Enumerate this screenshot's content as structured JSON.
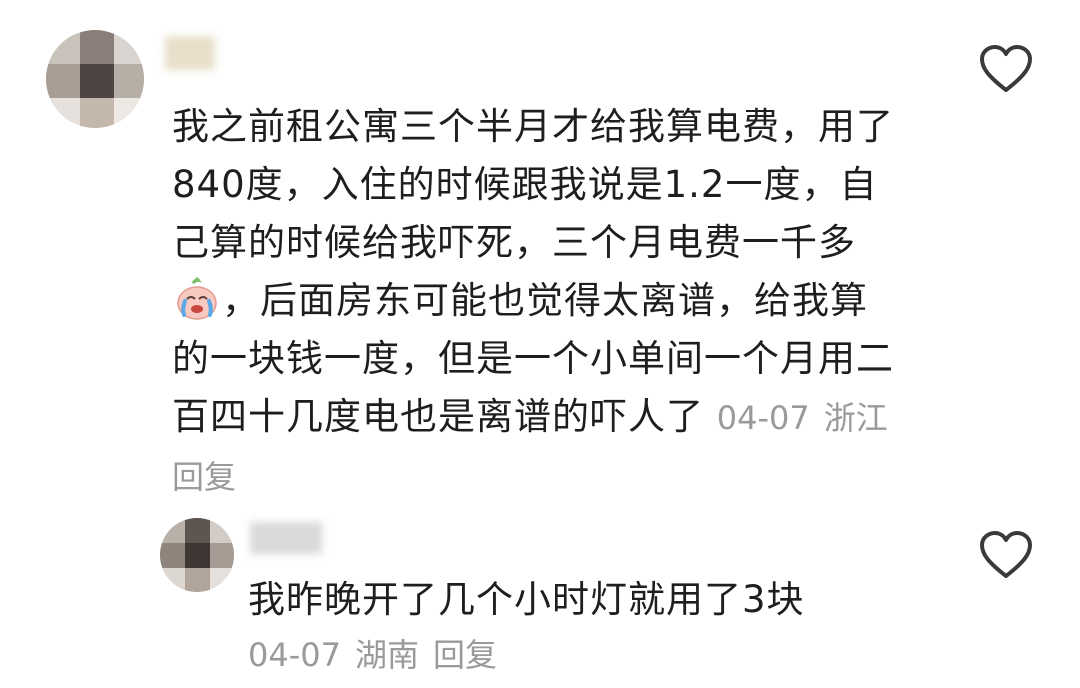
{
  "comments": [
    {
      "text_before_emoji": "我之前租公寓三个半月才给我算电费，用了840度，入住的时候跟我说是1.2一度，自己算的时候给我吓死，三个月电费一千多",
      "emoji": "crying-face-emoji",
      "text_after_emoji": "，后面房东可能也觉得太离谱，给我算的一块钱一度，但是一个小单间一个月用二百四十几度电也是离谱的吓人了",
      "date": "04-07",
      "location": "浙江",
      "reply_label": "回复",
      "like_icon": "heart-outline-icon"
    },
    {
      "text": "我昨晚开了几个小时灯就用了3块",
      "date": "04-07",
      "location": "湖南",
      "reply_label": "回复",
      "like_icon": "heart-outline-icon"
    }
  ],
  "colors": {
    "text": "#1e1e1e",
    "meta": "#9a9a9a",
    "icon": "#3a3a3a"
  }
}
